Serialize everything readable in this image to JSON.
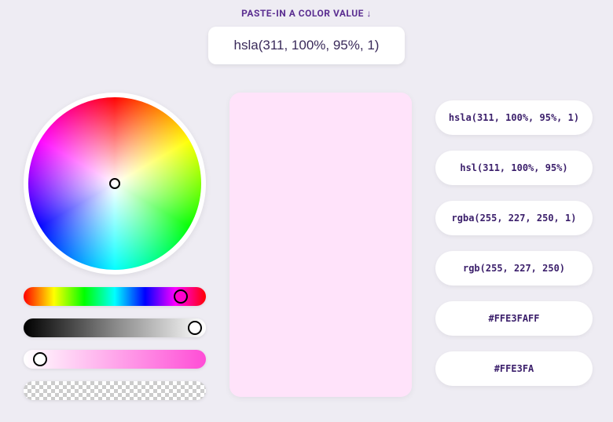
{
  "header": {
    "label": "PASTE-IN A COLOR VALUE ↓",
    "input_value": "hsla(311, 100%, 95%, 1)"
  },
  "swatch": {
    "color": "#FFE3FA"
  },
  "formats": {
    "hsla": "hsla(311, 100%, 95%, 1)",
    "hsl": "hsl(311, 100%, 95%)",
    "rgba": "rgba(255, 227, 250, 1)",
    "rgb": "rgb(255, 227, 250)",
    "hex8": "#FFE3FAFF",
    "hex6": "#FFE3FA"
  },
  "sliders": {
    "hue": 311,
    "saturation": 100,
    "lightness": 95,
    "alpha": 1
  }
}
